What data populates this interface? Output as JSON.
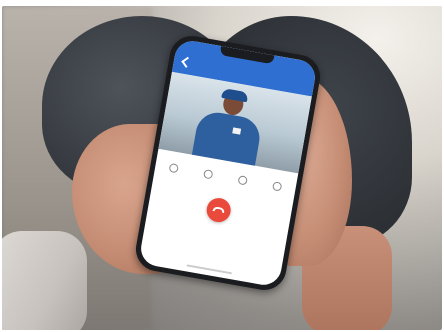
{
  "photo": {
    "description_icon": "person-holding-smartphone-image"
  },
  "phone_app": {
    "title": "",
    "timer": "",
    "accent_color": "#2f6fd1",
    "end_call_color": "#ea4a3b",
    "controls": [
      "speaker-icon",
      "microphone-icon",
      "unlock-icon",
      "snapshot-icon"
    ]
  }
}
